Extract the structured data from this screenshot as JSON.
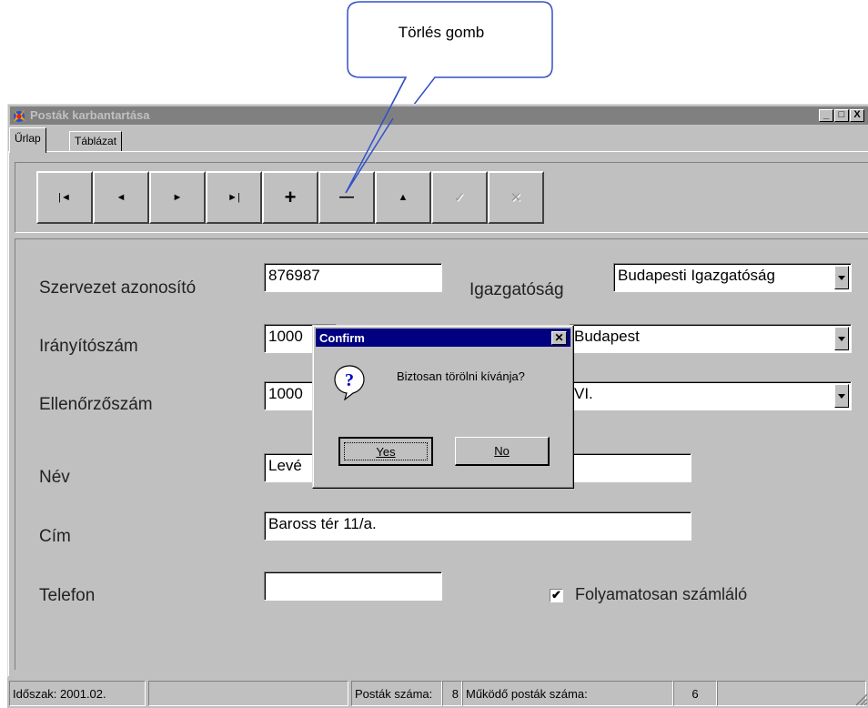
{
  "callout": {
    "text": "Törlés gomb"
  },
  "window": {
    "title": "Posták karbantartása",
    "controls": {
      "minimize": "_",
      "maximize": "□",
      "close": "X"
    }
  },
  "tabs": [
    {
      "label": "Űrlap",
      "active": true
    },
    {
      "label": "Táblázat",
      "active": false
    }
  ],
  "navigator": {
    "buttons": [
      {
        "name": "first",
        "glyph": "|◄",
        "enabled": true
      },
      {
        "name": "prior",
        "glyph": "◄",
        "enabled": true
      },
      {
        "name": "next",
        "glyph": "►",
        "enabled": true
      },
      {
        "name": "last",
        "glyph": "►|",
        "enabled": true
      },
      {
        "name": "insert",
        "glyph": "+",
        "enabled": true
      },
      {
        "name": "delete",
        "glyph": "—",
        "enabled": true
      },
      {
        "name": "edit",
        "glyph": "▲",
        "enabled": true
      },
      {
        "name": "post",
        "glyph": "✓",
        "enabled": false
      },
      {
        "name": "cancel",
        "glyph": "✕",
        "enabled": false
      }
    ]
  },
  "form": {
    "szervezet_label": "Szervezet azonosító",
    "szervezet_value": "876987",
    "igazgatosag_label": "Igazgatóság",
    "igazgatosag_value": "Budapesti Igazgatóság",
    "iranyitoszam_label": "Irányítószám",
    "iranyitoszam_value": "1000",
    "varos_value": "Budapest",
    "ellenorzoszam_label": "Ellenőrzőszám",
    "ellenorzoszam_value": "1000",
    "kerulet_value": "VI.",
    "nev_label": "Név",
    "nev_value": "Levé",
    "cim_label": "Cím",
    "cim_value": "Baross tér 11/a.",
    "telefon_label": "Telefon",
    "telefon_value": "",
    "folyamatos_label": "Folyamatosan számláló",
    "folyamatos_checked": true
  },
  "status": {
    "idoszak": "Időszak: 2001.02.",
    "postak_label": "Posták száma:",
    "postak_count": "8",
    "mukodo_label": "Működő posták száma:",
    "mukodo_count": "6"
  },
  "dialog": {
    "title": "Confirm",
    "message": "Biztosan törölni kívánja?",
    "yes_label": "Yes",
    "no_label": "No",
    "icon": "question-icon"
  },
  "colors": {
    "face": "#c0c0c0",
    "dialog_title": "#000080",
    "inactive_title": "#808080",
    "callout_border": "#3050c8"
  }
}
